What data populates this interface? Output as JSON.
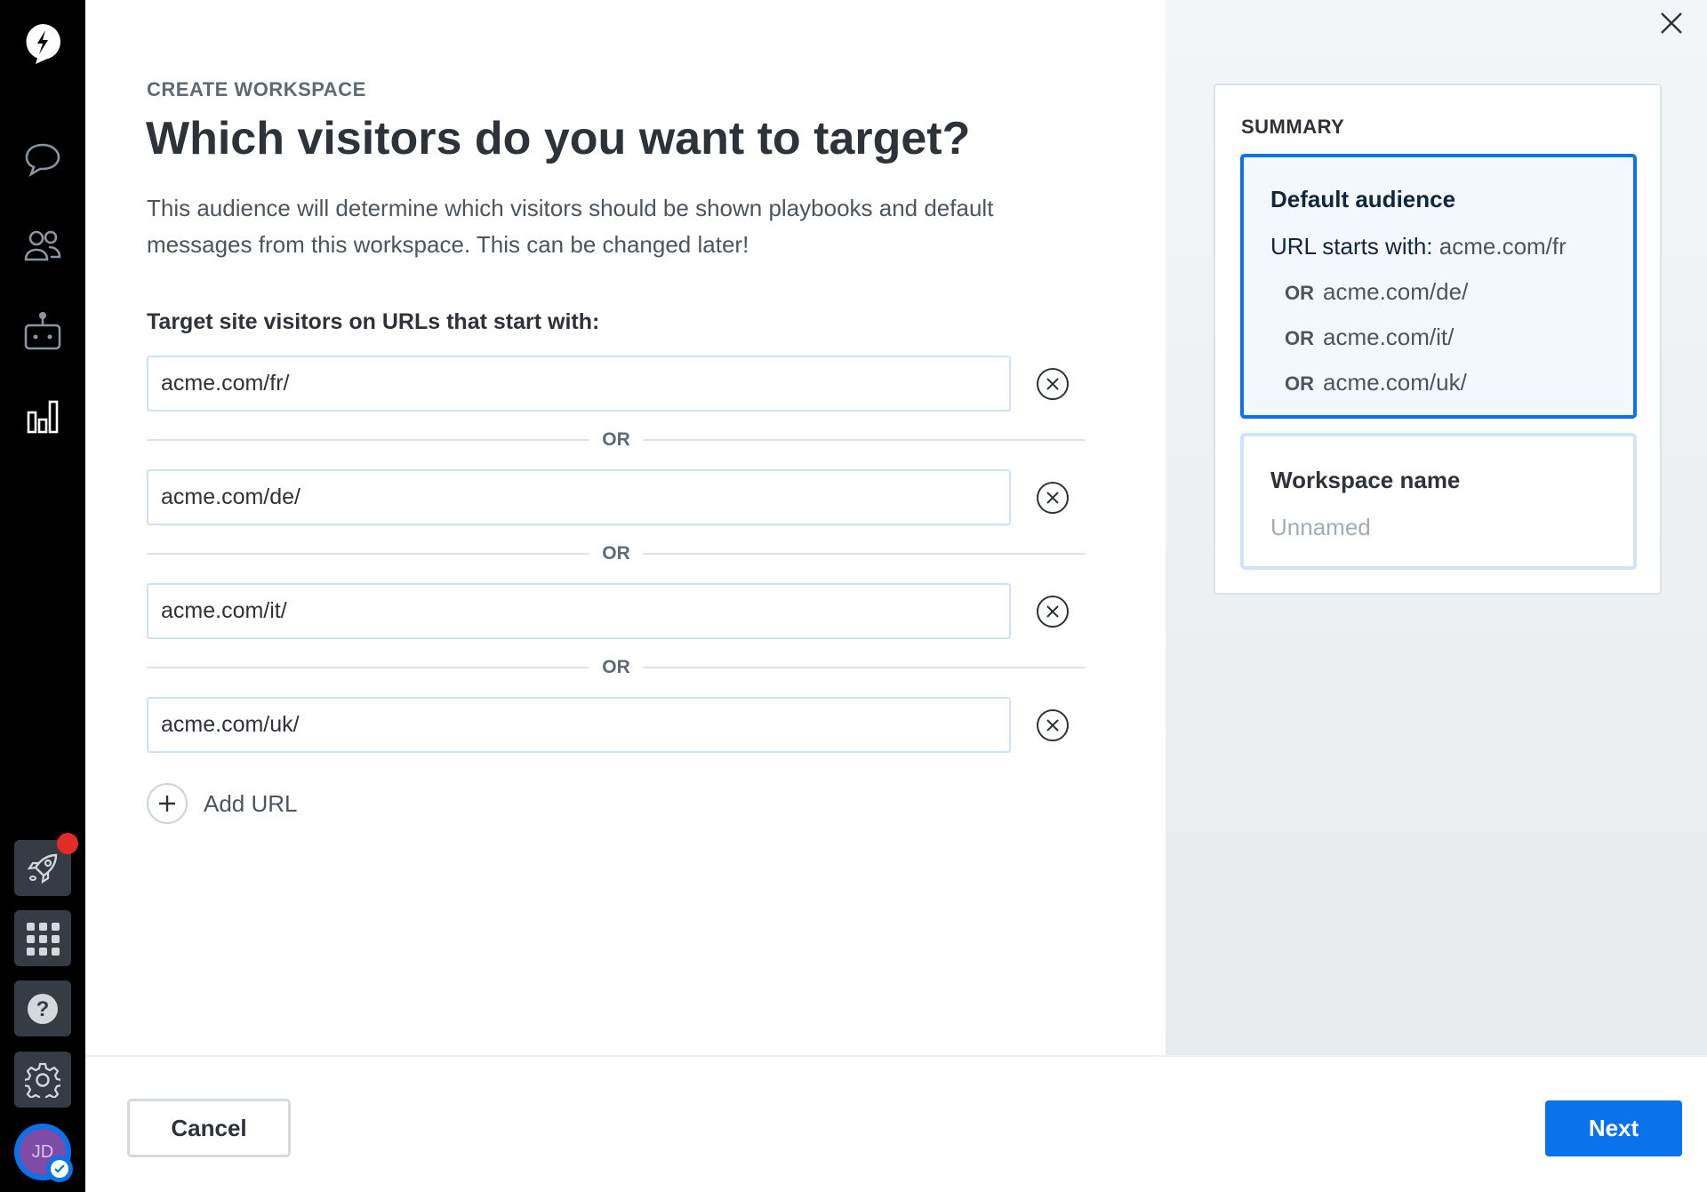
{
  "sidebar": {
    "nav_icons": [
      "logo-icon",
      "chat-icon",
      "people-icon",
      "bot-icon",
      "chart-icon"
    ],
    "bottom_icons": [
      "rocket-icon",
      "apps-grid-icon",
      "help-icon",
      "gear-icon"
    ],
    "notification_color": "#e32b27",
    "avatar_initials": "JD",
    "avatar_color": "#7e4ba6"
  },
  "main": {
    "eyebrow": "CREATE WORKSPACE",
    "title": "Which visitors do you want to target?",
    "description": "This audience will determine which visitors should be shown playbooks and default messages from this workspace. This can be changed later!",
    "field_label": "Target site visitors on URLs that start with:",
    "urls": [
      "acme.com/fr/",
      "acme.com/de/",
      "acme.com/it/",
      "acme.com/uk/"
    ],
    "separator": "OR",
    "add_url_label": "Add URL"
  },
  "summary": {
    "heading": "SUMMARY",
    "audience_title": "Default audience",
    "url_prefix_label": "URL starts with:",
    "first_url": "acme.com/fr",
    "or_label": "OR",
    "other_urls": [
      "acme.com/de/",
      "acme.com/it/",
      "acme.com/uk/"
    ],
    "workspace_name_title": "Workspace name",
    "workspace_name_value": "Unnamed"
  },
  "footer": {
    "cancel_label": "Cancel",
    "next_label": "Next"
  },
  "colors": {
    "accent": "#0a73eb",
    "sidebar_bg": "#000000"
  }
}
